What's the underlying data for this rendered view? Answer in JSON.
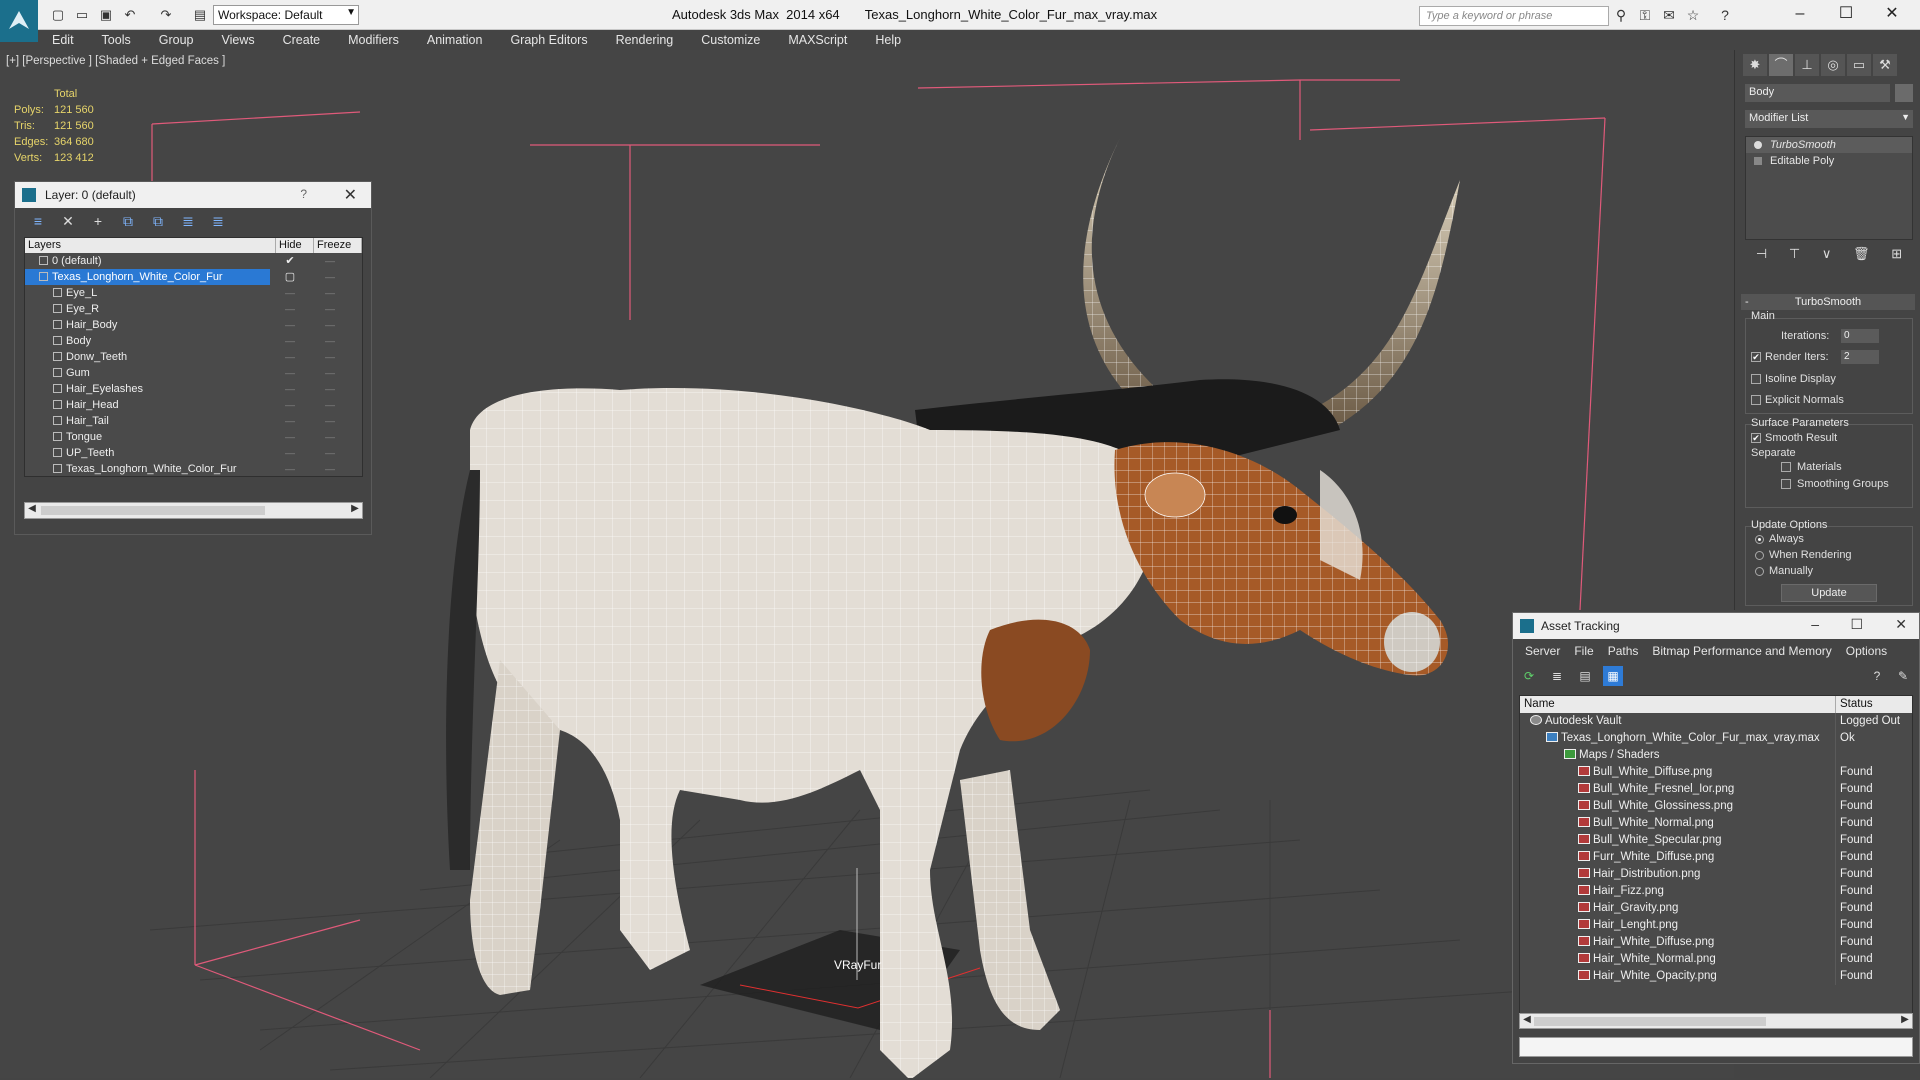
{
  "titlebar": {
    "app_title": "Autodesk 3ds Max  2014 x64",
    "file_title": "Texas_Longhorn_White_Color_Fur_max_vray.max",
    "workspace": "Workspace: Default",
    "search_placeholder": "Type a keyword or phrase"
  },
  "menu": [
    "Edit",
    "Tools",
    "Group",
    "Views",
    "Create",
    "Modifiers",
    "Animation",
    "Graph Editors",
    "Rendering",
    "Customize",
    "MAXScript",
    "Help"
  ],
  "viewport": {
    "label": "[+] [Perspective ] [Shaded + Edged Faces ]",
    "stats_header": "Total",
    "stats": [
      {
        "k": "Polys:",
        "v": "121 560"
      },
      {
        "k": "Tris:",
        "v": "121 560"
      },
      {
        "k": "Edges:",
        "v": "364 680"
      },
      {
        "k": "Verts:",
        "v": "123 412"
      }
    ],
    "helper_label": "VRayFur"
  },
  "layer_window": {
    "title": "Layer: 0 (default)",
    "help": "?",
    "columns": [
      "Layers",
      "Hide",
      "Freeze"
    ],
    "rows": [
      {
        "name": "0 (default)",
        "level": 1
      },
      {
        "name": "Texas_Longhorn_White_Color_Fur",
        "level": 1,
        "selected": true
      },
      {
        "name": "Eye_L",
        "level": 2
      },
      {
        "name": "Eye_R",
        "level": 2
      },
      {
        "name": "Hair_Body",
        "level": 2
      },
      {
        "name": "Body",
        "level": 2
      },
      {
        "name": "Donw_Teeth",
        "level": 2
      },
      {
        "name": "Gum",
        "level": 2
      },
      {
        "name": "Hair_Eyelashes",
        "level": 2
      },
      {
        "name": "Hair_Head",
        "level": 2
      },
      {
        "name": "Hair_Tail",
        "level": 2
      },
      {
        "name": "Tongue",
        "level": 2
      },
      {
        "name": "UP_Teeth",
        "level": 2
      },
      {
        "name": "Texas_Longhorn_White_Color_Fur",
        "level": 2
      }
    ]
  },
  "command_panel": {
    "object_name": "Body",
    "modifier_list": "Modifier List",
    "stack": [
      {
        "label": "TurboSmooth",
        "active": true
      },
      {
        "label": "Editable Poly",
        "active": false
      }
    ],
    "rollout_title": "TurboSmooth",
    "main_group": "Main",
    "iterations_label": "Iterations:",
    "iterations_value": "0",
    "render_iters_label": "Render Iters:",
    "render_iters_value": "2",
    "isoline_label": "Isoline Display",
    "explicit_normals_label": "Explicit Normals",
    "surface_group": "Surface Parameters",
    "smooth_result_label": "Smooth Result",
    "separate_label": "Separate",
    "materials_label": "Materials",
    "smoothing_groups_label": "Smoothing Groups",
    "update_group": "Update Options",
    "always_label": "Always",
    "when_rendering_label": "When Rendering",
    "manually_label": "Manually",
    "update_button": "Update"
  },
  "asset_tracking": {
    "title": "Asset Tracking",
    "menu": [
      "Server",
      "File",
      "Paths",
      "Bitmap Performance and Memory",
      "Options"
    ],
    "columns": [
      "Name",
      "Status"
    ],
    "rows": [
      {
        "name": "Autodesk Vault",
        "status": "Logged Out",
        "level": 1,
        "icon": "vault"
      },
      {
        "name": "Texas_Longhorn_White_Color_Fur_max_vray.max",
        "status": "Ok",
        "level": 2,
        "icon": "max"
      },
      {
        "name": "Maps / Shaders",
        "status": "",
        "level": 3,
        "icon": "folder"
      },
      {
        "name": "Bull_White_Diffuse.png",
        "status": "Found",
        "level": 4,
        "icon": "png"
      },
      {
        "name": "Bull_White_Fresnel_Ior.png",
        "status": "Found",
        "level": 4,
        "icon": "png"
      },
      {
        "name": "Bull_White_Glossiness.png",
        "status": "Found",
        "level": 4,
        "icon": "png"
      },
      {
        "name": "Bull_White_Normal.png",
        "status": "Found",
        "level": 4,
        "icon": "png"
      },
      {
        "name": "Bull_White_Specular.png",
        "status": "Found",
        "level": 4,
        "icon": "png"
      },
      {
        "name": "Furr_White_Diffuse.png",
        "status": "Found",
        "level": 4,
        "icon": "png"
      },
      {
        "name": "Hair_Distribution.png",
        "status": "Found",
        "level": 4,
        "icon": "png"
      },
      {
        "name": "Hair_Fizz.png",
        "status": "Found",
        "level": 4,
        "icon": "png"
      },
      {
        "name": "Hair_Gravity.png",
        "status": "Found",
        "level": 4,
        "icon": "png"
      },
      {
        "name": "Hair_Lenght.png",
        "status": "Found",
        "level": 4,
        "icon": "png"
      },
      {
        "name": "Hair_White_Diffuse.png",
        "status": "Found",
        "level": 4,
        "icon": "png"
      },
      {
        "name": "Hair_White_Normal.png",
        "status": "Found",
        "level": 4,
        "icon": "png"
      },
      {
        "name": "Hair_White_Opacity.png",
        "status": "Found",
        "level": 4,
        "icon": "png"
      }
    ]
  },
  "colors": {
    "viewport_bg": "#454545",
    "selection": "#2a79d4",
    "bbox": "#e05a7a",
    "stats": "#e6d46a"
  }
}
